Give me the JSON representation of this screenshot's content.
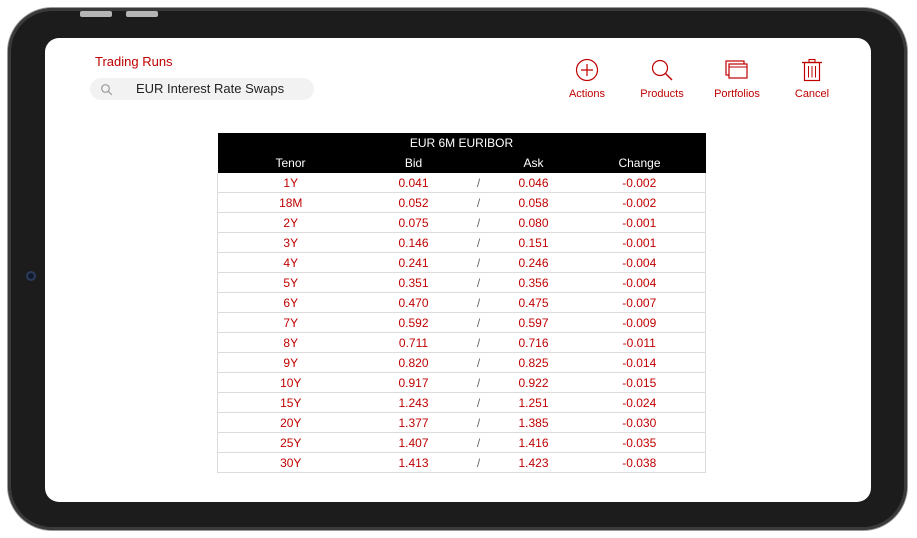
{
  "app": {
    "title": "Trading Runs",
    "search_value": "EUR Interest Rate Swaps"
  },
  "toolbar": {
    "items": [
      {
        "label": "Actions",
        "icon": "plus-circle-icon"
      },
      {
        "label": "Products",
        "icon": "magnifier-icon"
      },
      {
        "label": "Portfolios",
        "icon": "stacked-windows-icon"
      },
      {
        "label": "Cancel",
        "icon": "trash-icon"
      }
    ]
  },
  "colors": {
    "accent": "#c00000",
    "header_bg": "#000000",
    "device_bezel": "#1c1c1c"
  },
  "table": {
    "title": "EUR 6M EURIBOR",
    "columns": {
      "tenor": "Tenor",
      "bid": "Bid",
      "ask": "Ask",
      "change": "Change"
    },
    "separator": "/",
    "rows": [
      {
        "tenor": "1Y",
        "bid": "0.041",
        "ask": "0.046",
        "change": "-0.002"
      },
      {
        "tenor": "18M",
        "bid": "0.052",
        "ask": "0.058",
        "change": "-0.002"
      },
      {
        "tenor": "2Y",
        "bid": "0.075",
        "ask": "0.080",
        "change": "-0.001"
      },
      {
        "tenor": "3Y",
        "bid": "0.146",
        "ask": "0.151",
        "change": "-0.001"
      },
      {
        "tenor": "4Y",
        "bid": "0.241",
        "ask": "0.246",
        "change": "-0.004"
      },
      {
        "tenor": "5Y",
        "bid": "0.351",
        "ask": "0.356",
        "change": "-0.004"
      },
      {
        "tenor": "6Y",
        "bid": "0.470",
        "ask": "0.475",
        "change": "-0.007"
      },
      {
        "tenor": "7Y",
        "bid": "0.592",
        "ask": "0.597",
        "change": "-0.009"
      },
      {
        "tenor": "8Y",
        "bid": "0.711",
        "ask": "0.716",
        "change": "-0.011"
      },
      {
        "tenor": "9Y",
        "bid": "0.820",
        "ask": "0.825",
        "change": "-0.014"
      },
      {
        "tenor": "10Y",
        "bid": "0.917",
        "ask": "0.922",
        "change": "-0.015"
      },
      {
        "tenor": "15Y",
        "bid": "1.243",
        "ask": "1.251",
        "change": "-0.024"
      },
      {
        "tenor": "20Y",
        "bid": "1.377",
        "ask": "1.385",
        "change": "-0.030"
      },
      {
        "tenor": "25Y",
        "bid": "1.407",
        "ask": "1.416",
        "change": "-0.035"
      },
      {
        "tenor": "30Y",
        "bid": "1.413",
        "ask": "1.423",
        "change": "-0.038"
      }
    ]
  }
}
